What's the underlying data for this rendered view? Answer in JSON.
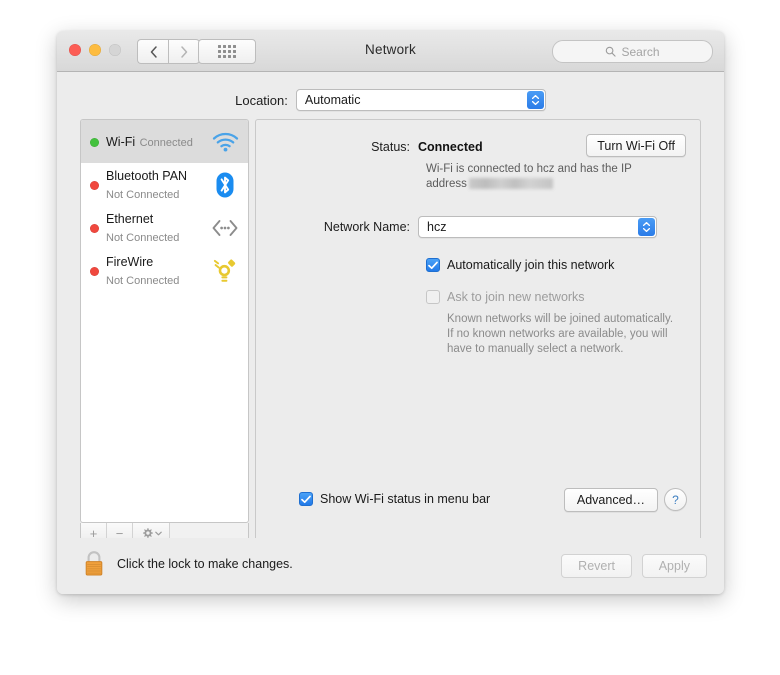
{
  "window": {
    "title": "Network",
    "traffic_lights": [
      "close-button",
      "minimize-button",
      "zoom-button"
    ],
    "nav": {
      "back": "‹",
      "forward": "›"
    },
    "show_all_label": "show-all-grid",
    "search": {
      "placeholder": "Search",
      "value": ""
    }
  },
  "location": {
    "label": "Location:",
    "value": "Automatic"
  },
  "sidebar": {
    "services": [
      {
        "name": "Wi-Fi",
        "state": "Connected",
        "dot": "green",
        "icon": "wifi-icon",
        "selected": true
      },
      {
        "name": "Bluetooth PAN",
        "state": "Not Connected",
        "dot": "red",
        "icon": "bluetooth-icon",
        "selected": false
      },
      {
        "name": "Ethernet",
        "state": "Not Connected",
        "dot": "red",
        "icon": "ethernet-icon",
        "selected": false
      },
      {
        "name": "FireWire",
        "state": "Not Connected",
        "dot": "red",
        "icon": "firewire-icon",
        "selected": false
      }
    ],
    "toolbar": {
      "add": "+",
      "remove": "−",
      "actions": "gear-icon"
    }
  },
  "pane": {
    "status_label": "Status:",
    "status_value": "Connected",
    "turn_off_button": "Turn Wi-Fi Off",
    "status_description_pre": "Wi-Fi is connected to hcz and has the IP address",
    "status_description_redacted": "",
    "network_name_label": "Network Name:",
    "network_name_value": "hcz",
    "auto_join_label": "Automatically join this network",
    "auto_join_checked": true,
    "ask_join_label": "Ask to join new networks",
    "ask_join_checked": false,
    "help_text": "Known networks will be joined automatically. If no known networks are available, you will have to manually select a network.",
    "show_status_label": "Show Wi-Fi status in menu bar",
    "show_status_checked": true,
    "advanced_button": "Advanced…",
    "help_button": "?"
  },
  "footer": {
    "lock_icon": "lock-closed-icon",
    "lock_text": "Click the lock to make changes.",
    "revert_button": "Revert",
    "apply_button": "Apply"
  },
  "colors": {
    "accent_blue": "#2b7ce8",
    "status_connected": "#43c13d",
    "status_disconnected": "#f0483e",
    "window_bg": "#ececec",
    "selection_bg": "#dcdcdc",
    "lock_body": "#f0a03c"
  }
}
